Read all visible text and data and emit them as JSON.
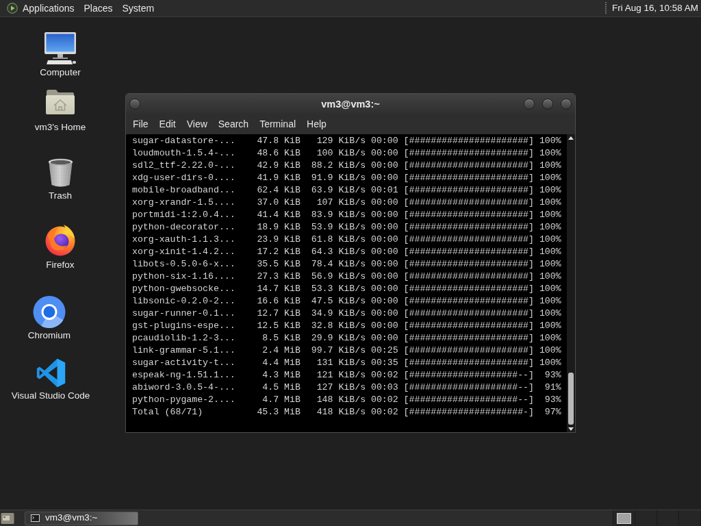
{
  "top_panel": {
    "menus": [
      "Applications",
      "Places",
      "System"
    ],
    "clock": "Fri Aug 16, 10:58 AM"
  },
  "desktop_icons": [
    {
      "kind": "computer",
      "label": "Computer"
    },
    {
      "kind": "home",
      "label": "vm3's Home"
    },
    {
      "kind": "trash",
      "label": "Trash"
    },
    {
      "kind": "firefox",
      "label": "Firefox"
    },
    {
      "kind": "chromium",
      "label": "Chromium"
    },
    {
      "kind": "vscode",
      "label": "Visual Studio Code"
    }
  ],
  "terminal": {
    "title": "vm3@vm3:~",
    "menu": [
      "File",
      "Edit",
      "View",
      "Search",
      "Terminal",
      "Help"
    ],
    "lines": [
      {
        "name": "sugar-datastore-...",
        "size": "47.8 KiB",
        "rate": "129 KiB/s",
        "eta": "00:00",
        "bar": "[######################]",
        "percent": "100%"
      },
      {
        "name": "loudmouth-1.5.4-...",
        "size": "48.6 KiB",
        "rate": "100 KiB/s",
        "eta": "00:00",
        "bar": "[######################]",
        "percent": "100%"
      },
      {
        "name": "sdl2_ttf-2.22.0-...",
        "size": "42.9 KiB",
        "rate": "88.2 KiB/s",
        "eta": "00:00",
        "bar": "[######################]",
        "percent": "100%"
      },
      {
        "name": "xdg-user-dirs-0....",
        "size": "41.9 KiB",
        "rate": "91.9 KiB/s",
        "eta": "00:00",
        "bar": "[######################]",
        "percent": "100%"
      },
      {
        "name": "mobile-broadband...",
        "size": "62.4 KiB",
        "rate": "63.9 KiB/s",
        "eta": "00:01",
        "bar": "[######################]",
        "percent": "100%"
      },
      {
        "name": "xorg-xrandr-1.5....",
        "size": "37.0 KiB",
        "rate": "107 KiB/s",
        "eta": "00:00",
        "bar": "[######################]",
        "percent": "100%"
      },
      {
        "name": "portmidi-1:2.0.4...",
        "size": "41.4 KiB",
        "rate": "83.9 KiB/s",
        "eta": "00:00",
        "bar": "[######################]",
        "percent": "100%"
      },
      {
        "name": "python-decorator...",
        "size": "18.9 KiB",
        "rate": "53.9 KiB/s",
        "eta": "00:00",
        "bar": "[######################]",
        "percent": "100%"
      },
      {
        "name": "xorg-xauth-1.1.3...",
        "size": "23.9 KiB",
        "rate": "61.8 KiB/s",
        "eta": "00:00",
        "bar": "[######################]",
        "percent": "100%"
      },
      {
        "name": "xorg-xinit-1.4.2...",
        "size": "17.2 KiB",
        "rate": "64.3 KiB/s",
        "eta": "00:00",
        "bar": "[######################]",
        "percent": "100%"
      },
      {
        "name": "libots-0.5.0-6-x...",
        "size": "35.5 KiB",
        "rate": "78.4 KiB/s",
        "eta": "00:00",
        "bar": "[######################]",
        "percent": "100%"
      },
      {
        "name": "python-six-1.16....",
        "size": "27.3 KiB",
        "rate": "56.9 KiB/s",
        "eta": "00:00",
        "bar": "[######################]",
        "percent": "100%"
      },
      {
        "name": "python-gwebsocke...",
        "size": "14.7 KiB",
        "rate": "53.3 KiB/s",
        "eta": "00:00",
        "bar": "[######################]",
        "percent": "100%"
      },
      {
        "name": "libsonic-0.2.0-2...",
        "size": "16.6 KiB",
        "rate": "47.5 KiB/s",
        "eta": "00:00",
        "bar": "[######################]",
        "percent": "100%"
      },
      {
        "name": "sugar-runner-0.1...",
        "size": "12.7 KiB",
        "rate": "34.9 KiB/s",
        "eta": "00:00",
        "bar": "[######################]",
        "percent": "100%"
      },
      {
        "name": "gst-plugins-espe...",
        "size": "12.5 KiB",
        "rate": "32.8 KiB/s",
        "eta": "00:00",
        "bar": "[######################]",
        "percent": "100%"
      },
      {
        "name": "pcaudiolib-1.2-3...",
        "size": "8.5 KiB",
        "rate": "29.9 KiB/s",
        "eta": "00:00",
        "bar": "[######################]",
        "percent": "100%"
      },
      {
        "name": "link-grammar-5.1...",
        "size": "2.4 MiB",
        "rate": "99.7 KiB/s",
        "eta": "00:25",
        "bar": "[######################]",
        "percent": "100%"
      },
      {
        "name": "sugar-activity-t...",
        "size": "4.4 MiB",
        "rate": "131 KiB/s",
        "eta": "00:35",
        "bar": "[######################]",
        "percent": "100%"
      },
      {
        "name": "espeak-ng-1.51.1...",
        "size": "4.3 MiB",
        "rate": "121 KiB/s",
        "eta": "00:02",
        "bar": "[####################--]",
        "percent": "93%"
      },
      {
        "name": "abiword-3.0.5-4-...",
        "size": "4.5 MiB",
        "rate": "127 KiB/s",
        "eta": "00:03",
        "bar": "[####################--]",
        "percent": "91%"
      },
      {
        "name": "python-pygame-2....",
        "size": "4.7 MiB",
        "rate": "148 KiB/s",
        "eta": "00:02",
        "bar": "[####################--]",
        "percent": "93%"
      },
      {
        "name": "Total (68/71)",
        "size": "45.3 MiB",
        "rate": "418 KiB/s",
        "eta": "00:02",
        "bar": "[#####################-]",
        "percent": "97%"
      }
    ]
  },
  "bottom_panel": {
    "tasks": [
      {
        "label": "vm3@vm3:~",
        "selected": true
      }
    ]
  }
}
